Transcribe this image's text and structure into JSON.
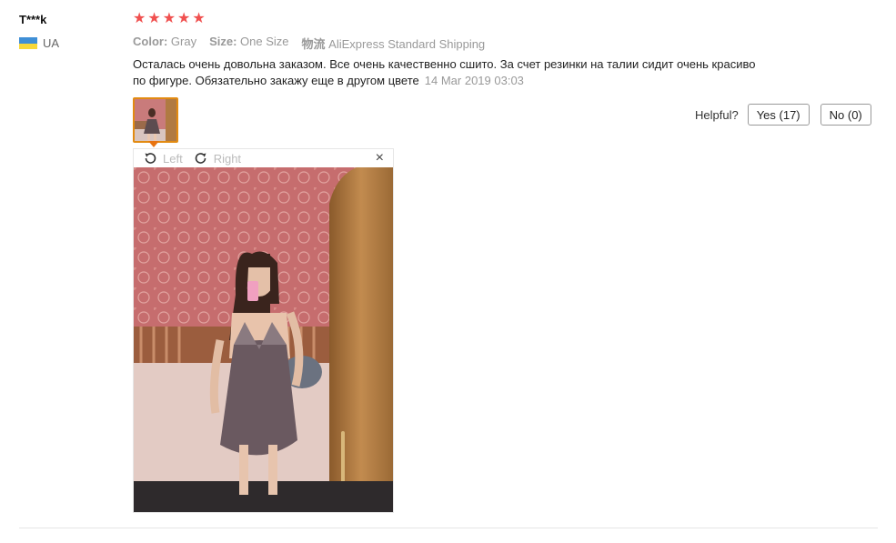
{
  "review": {
    "user": "T***k",
    "country": "UA",
    "rating": 5,
    "rating_stars": [
      "★",
      "★",
      "★",
      "★",
      "★"
    ],
    "meta": {
      "color_label": "Color:",
      "color_value": "Gray",
      "size_label": "Size:",
      "size_value": "One Size",
      "shipping_label": "物流",
      "shipping_value": "AliExpress Standard Shipping"
    },
    "text": "Осталась очень довольна заказом. Все очень качественно сшито. За счет резинки на талии сидит очень красиво по фигуре. Обязательно закажу еще в другом цвете",
    "date": "14 Mar 2019 03:03"
  },
  "helpful": {
    "label": "Helpful?",
    "yes": "Yes (17)",
    "no": "No (0)"
  },
  "viewer": {
    "rotate_left": "Left",
    "rotate_right": "Right",
    "close": "×"
  },
  "colors": {
    "star": "#f0504f",
    "thumb_border": "#e28b12",
    "muted": "#999999"
  },
  "icons": {
    "rotate_left": "rotate-left-icon",
    "rotate_right": "rotate-right-icon",
    "close": "close-icon",
    "flag": "ukraine-flag-icon"
  }
}
